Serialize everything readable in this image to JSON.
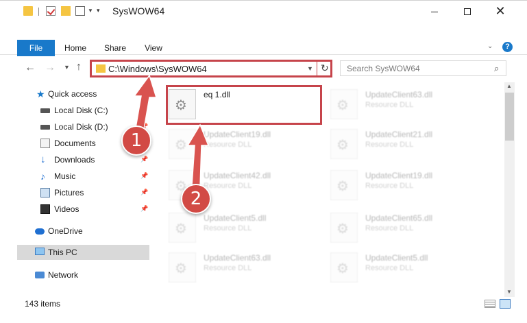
{
  "window": {
    "title": "SysWOW64",
    "minimize_label": "",
    "maximize_label": "",
    "close_label": "✕"
  },
  "ribbon": {
    "tabs": [
      {
        "label": "File"
      },
      {
        "label": "Home"
      },
      {
        "label": "Share"
      },
      {
        "label": "View"
      }
    ],
    "help_label": "?"
  },
  "address_bar": {
    "path": "C:\\Windows\\SysWOW64"
  },
  "search": {
    "placeholder": "Search SysWOW64"
  },
  "sidebar": {
    "items": [
      {
        "label": "Quick access",
        "icon": "star-icon",
        "pinned": false
      },
      {
        "label": "Local Disk (C:)",
        "icon": "drive-icon",
        "pinned": true
      },
      {
        "label": "Local Disk (D:)",
        "icon": "drive-icon",
        "pinned": true
      },
      {
        "label": "Documents",
        "icon": "documents-icon",
        "pinned": true
      },
      {
        "label": "Downloads",
        "icon": "download-icon",
        "pinned": true
      },
      {
        "label": "Music",
        "icon": "music-icon",
        "pinned": true
      },
      {
        "label": "Pictures",
        "icon": "pictures-icon",
        "pinned": true
      },
      {
        "label": "Videos",
        "icon": "videos-icon",
        "pinned": true
      },
      {
        "label": "OneDrive",
        "icon": "cloud-icon",
        "pinned": false
      },
      {
        "label": "This PC",
        "icon": "computer-icon",
        "pinned": false,
        "selected": true
      },
      {
        "label": "Network",
        "icon": "network-icon",
        "pinned": false
      }
    ]
  },
  "files": [
    {
      "name": "eq 1.dll",
      "type": "",
      "highlighted": true
    },
    {
      "name": "UpdateClient63.dll",
      "type": "Resource DLL"
    },
    {
      "name": "UpdateClient19.dll",
      "type": "Resource DLL"
    },
    {
      "name": "UpdateClient21.dll",
      "type": "Resource DLL"
    },
    {
      "name": "UpdateClient42.dll",
      "type": "Resource DLL"
    },
    {
      "name": "UpdateClient19.dll",
      "type": "Resource DLL"
    },
    {
      "name": "UpdateClient5.dll",
      "type": "Resource DLL"
    },
    {
      "name": "UpdateClient65.dll",
      "type": "Resource DLL"
    },
    {
      "name": "UpdateClient63.dll",
      "type": "Resource DLL"
    },
    {
      "name": "UpdateClient5.dll",
      "type": "Resource DLL"
    }
  ],
  "status": {
    "item_count": "143 items"
  },
  "callouts": [
    {
      "number": "1"
    },
    {
      "number": "2"
    }
  ],
  "colors": {
    "accent": "#1979ca",
    "highlight_red": "#c6444b",
    "callout_red": "#d24a45"
  }
}
